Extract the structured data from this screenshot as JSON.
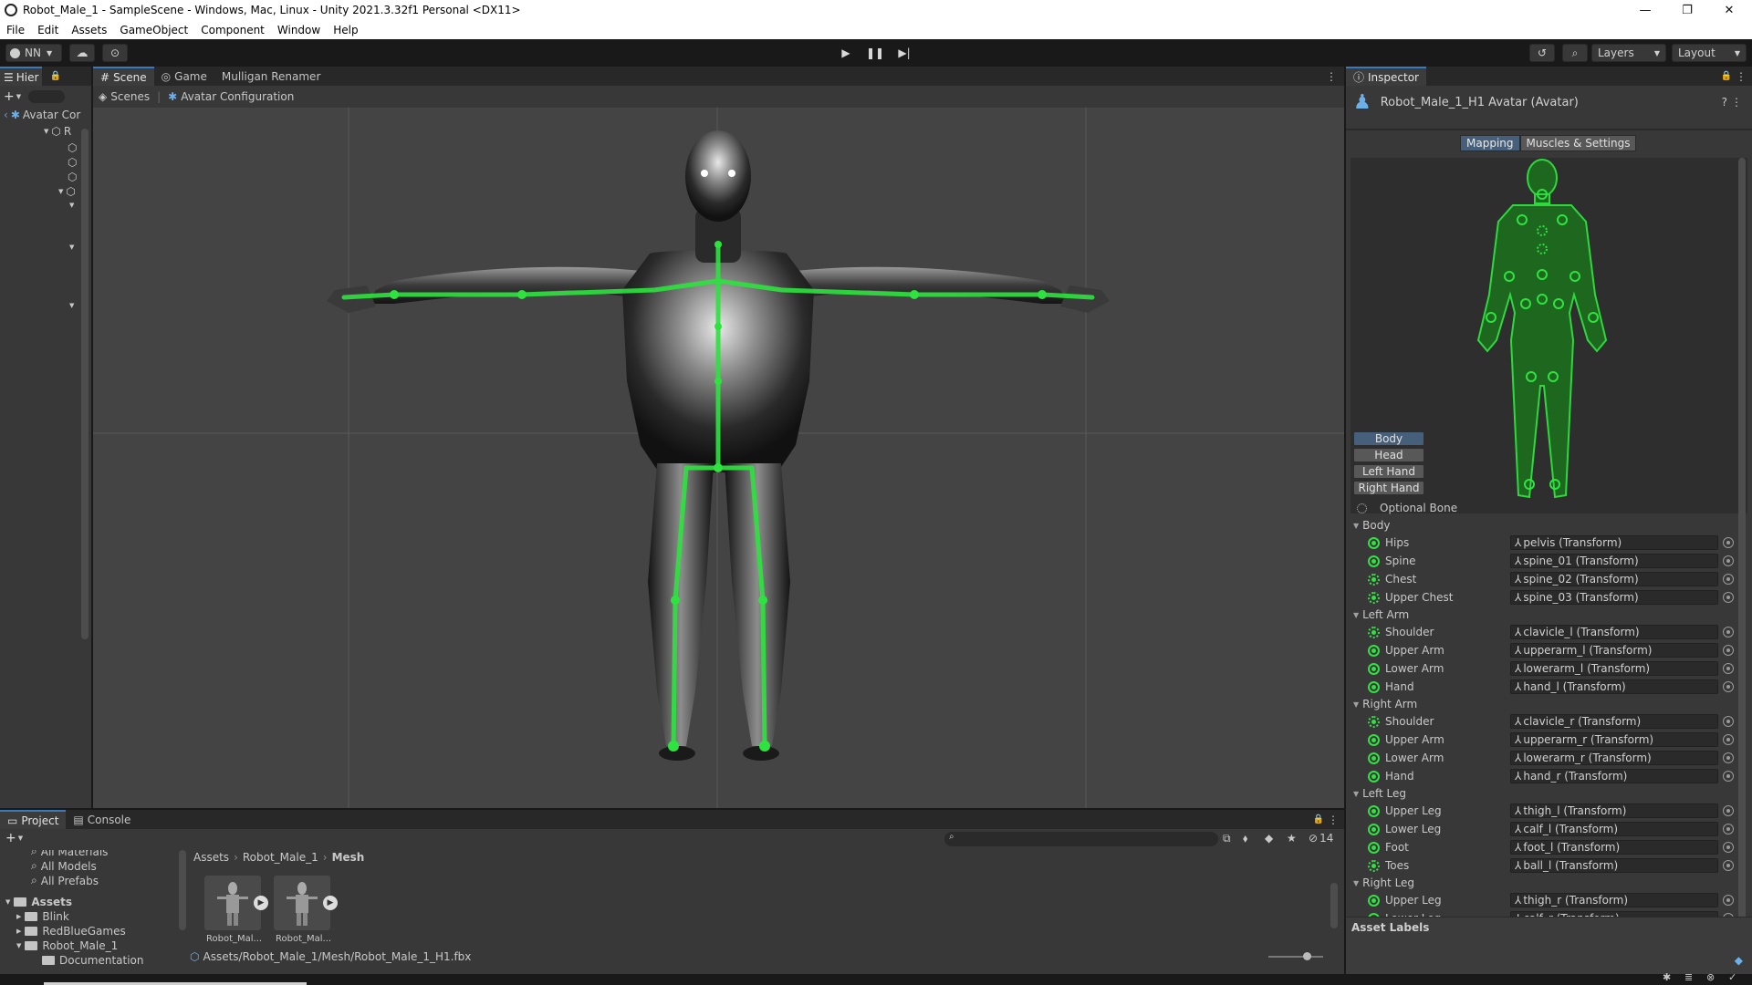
{
  "window": {
    "title": "Robot_Male_1 - SampleScene - Windows, Mac, Linux - Unity 2021.3.32f1 Personal <DX11>",
    "controls": [
      "—",
      "❐",
      "✕"
    ]
  },
  "menu": [
    "File",
    "Edit",
    "Assets",
    "GameObject",
    "Component",
    "Window",
    "Help"
  ],
  "toolbar": {
    "account": "NN",
    "layers": "Layers",
    "layout": "Layout"
  },
  "hierarchy": {
    "tab": "Hier",
    "root": "Avatar Cor",
    "item": "R"
  },
  "scene": {
    "tabs": [
      "Scene",
      "Game",
      "Mulligan Renamer"
    ],
    "breadcrumb": [
      "Scenes",
      "Avatar Configuration"
    ]
  },
  "inspector": {
    "tab": "Inspector",
    "title": "Robot_Male_1_H1 Avatar (Avatar)",
    "mode_tabs": [
      "Mapping",
      "Muscles & Settings"
    ],
    "parts": [
      "Body",
      "Head",
      "Left Hand",
      "Right Hand"
    ],
    "optional_bone": "Optional Bone",
    "sections": [
      {
        "name": "Body",
        "bones": [
          {
            "label": "Hips",
            "value": "pelvis (Transform)"
          },
          {
            "label": "Spine",
            "value": "spine_01 (Transform)"
          },
          {
            "label": "Chest",
            "value": "spine_02 (Transform)"
          },
          {
            "label": "Upper Chest",
            "value": "spine_03 (Transform)"
          }
        ]
      },
      {
        "name": "Left Arm",
        "bones": [
          {
            "label": "Shoulder",
            "value": "clavicle_l (Transform)"
          },
          {
            "label": "Upper Arm",
            "value": "upperarm_l (Transform)"
          },
          {
            "label": "Lower Arm",
            "value": "lowerarm_l (Transform)"
          },
          {
            "label": "Hand",
            "value": "hand_l (Transform)"
          }
        ]
      },
      {
        "name": "Right Arm",
        "bones": [
          {
            "label": "Shoulder",
            "value": "clavicle_r (Transform)"
          },
          {
            "label": "Upper Arm",
            "value": "upperarm_r (Transform)"
          },
          {
            "label": "Lower Arm",
            "value": "lowerarm_r (Transform)"
          },
          {
            "label": "Hand",
            "value": "hand_r (Transform)"
          }
        ]
      },
      {
        "name": "Left Leg",
        "bones": [
          {
            "label": "Upper Leg",
            "value": "thigh_l (Transform)"
          },
          {
            "label": "Lower Leg",
            "value": "calf_l (Transform)"
          },
          {
            "label": "Foot",
            "value": "foot_l (Transform)"
          },
          {
            "label": "Toes",
            "value": "ball_l (Transform)"
          }
        ]
      },
      {
        "name": "Right Leg",
        "bones": [
          {
            "label": "Upper Leg",
            "value": "thigh_r (Transform)"
          },
          {
            "label": "Lower Leg",
            "value": "calf_r (Transform)"
          }
        ]
      }
    ],
    "asset_labels": "Asset Labels"
  },
  "project": {
    "tabs": [
      "Project",
      "Console"
    ],
    "favorites": [
      "All Materials",
      "All Models",
      "All Prefabs"
    ],
    "tree": [
      "Assets",
      "Blink",
      "RedBlueGames",
      "Robot_Male_1",
      "Documentation"
    ],
    "breadcrumb": [
      "Assets",
      "Robot_Male_1",
      "Mesh"
    ],
    "items": [
      "Robot_Mal...",
      "Robot_Mal..."
    ],
    "path": "Assets/Robot_Male_1/Mesh/Robot_Male_1_H1.fbx",
    "hidden_count": "14"
  },
  "colors": {
    "accent": "#3a79bb",
    "bone_green": "#2ee33f",
    "panel": "#383838",
    "viewport": "#444444"
  }
}
